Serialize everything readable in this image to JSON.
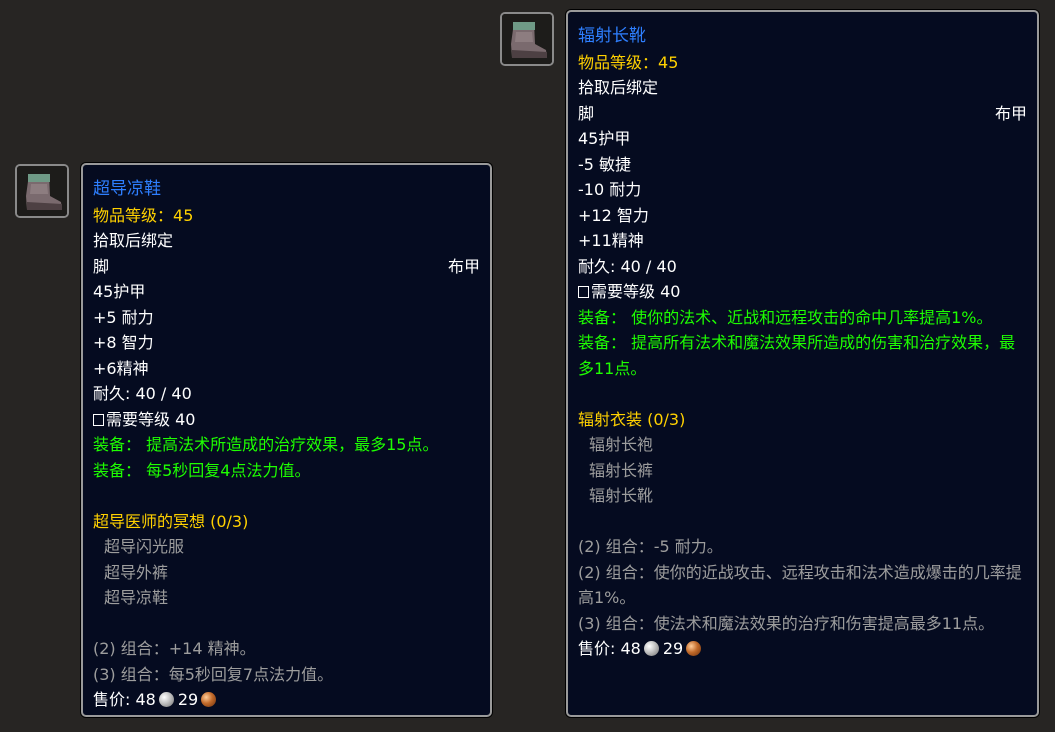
{
  "left": {
    "icon": "boot-icon",
    "name": "超导凉鞋",
    "level_label": "物品等级：",
    "level_value": "45",
    "bind": "拾取后绑定",
    "slot": "脚",
    "type": "布甲",
    "armor": "45护甲",
    "stats": [
      "+5 耐力",
      "+8 智力",
      "+6精神"
    ],
    "durability": "耐久: 40 / 40",
    "req_level": "需要等级 40",
    "equip_effects": [
      {
        "label": "装备：",
        "text": "提高法术所造成的治疗效果，最多15点。"
      },
      {
        "label": "装备：",
        "text": "每5秒回复4点法力值。"
      }
    ],
    "set_name": "超导医师的冥想 (0/3)",
    "set_items": [
      "超导闪光服",
      "超导外裤",
      "超导凉鞋"
    ],
    "set_bonuses": [
      "(2) 组合：+14 精神。",
      "(3) 组合：每5秒回复7点法力值。"
    ],
    "sell_label": "售价:",
    "sell_silver": "48",
    "sell_copper": "29"
  },
  "right": {
    "icon": "boot-icon",
    "name": "辐射长靴",
    "level_label": "物品等级：",
    "level_value": "45",
    "bind": "拾取后绑定",
    "slot": "脚",
    "type": "布甲",
    "armor": "45护甲",
    "stats": [
      "-5 敏捷",
      "-10 耐力",
      "+12 智力",
      "+11精神"
    ],
    "durability": "耐久: 40 / 40",
    "req_level": "需要等级 40",
    "equip_effects": [
      {
        "label": "装备：",
        "text": "使你的法术、近战和远程攻击的命中几率提高1%。"
      },
      {
        "label": "装备：",
        "text": "提高所有法术和魔法效果所造成的伤害和治疗效果，最多11点。"
      }
    ],
    "set_name": "辐射衣装 (0/3)",
    "set_items": [
      "辐射长袍",
      "辐射长裤",
      "辐射长靴"
    ],
    "set_bonuses": [
      "(2) 组合：-5 耐力。",
      "(2) 组合：使你的近战攻击、远程攻击和法术造成爆击的几率提高1%。",
      "(3) 组合：使法术和魔法效果的治疗和伤害提高最多11点。"
    ],
    "sell_label": "售价:",
    "sell_silver": "48",
    "sell_copper": "29"
  },
  "colors": {
    "background": "#272523",
    "tooltip_bg": "#050b20",
    "item_name_blue": "#2e7fff",
    "gold": "#ffd100",
    "equip_green": "#1eff00",
    "set_grey": "#9d9d9d"
  }
}
